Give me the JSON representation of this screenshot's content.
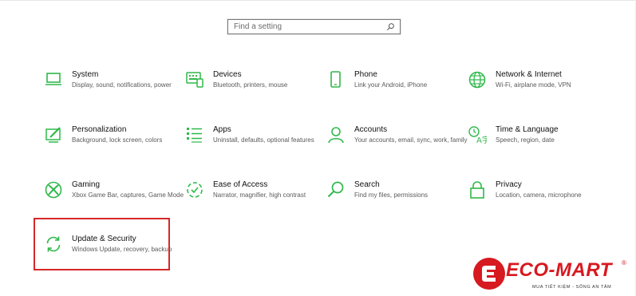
{
  "search": {
    "placeholder": "Find a setting"
  },
  "tiles": [
    {
      "title": "System",
      "desc": "Display, sound, notifications, power",
      "icon": "monitor-icon"
    },
    {
      "title": "Devices",
      "desc": "Bluetooth, printers, mouse",
      "icon": "keyboard-icon"
    },
    {
      "title": "Phone",
      "desc": "Link your Android, iPhone",
      "icon": "phone-icon"
    },
    {
      "title": "Network & Internet",
      "desc": "Wi-Fi, airplane mode, VPN",
      "icon": "globe-icon"
    },
    {
      "title": "Personalization",
      "desc": "Background, lock screen, colors",
      "icon": "paint-icon"
    },
    {
      "title": "Apps",
      "desc": "Uninstall, defaults, optional features",
      "icon": "apps-list-icon"
    },
    {
      "title": "Accounts",
      "desc": "Your accounts, email, sync, work, family",
      "icon": "person-icon"
    },
    {
      "title": "Time & Language",
      "desc": "Speech, region, date",
      "icon": "time-language-icon"
    },
    {
      "title": "Gaming",
      "desc": "Xbox Game Bar, captures, Game Mode",
      "icon": "xbox-icon"
    },
    {
      "title": "Ease of Access",
      "desc": "Narrator, magnifier, high contrast",
      "icon": "ease-of-access-icon"
    },
    {
      "title": "Search",
      "desc": "Find my files, permissions",
      "icon": "magnifier-icon"
    },
    {
      "title": "Privacy",
      "desc": "Location, camera, microphone",
      "icon": "lock-icon"
    },
    {
      "title": "Update & Security",
      "desc": "Windows Update, recovery, backup",
      "icon": "sync-icon"
    }
  ],
  "logo": {
    "name": "ECO-MART",
    "registered": "®",
    "slogan": "MUA TIẾT KIỆM - SỐNG AN TÂM"
  },
  "colors": {
    "accent": "#2fb84a",
    "highlight": "#d62828",
    "brand": "#d71920"
  }
}
